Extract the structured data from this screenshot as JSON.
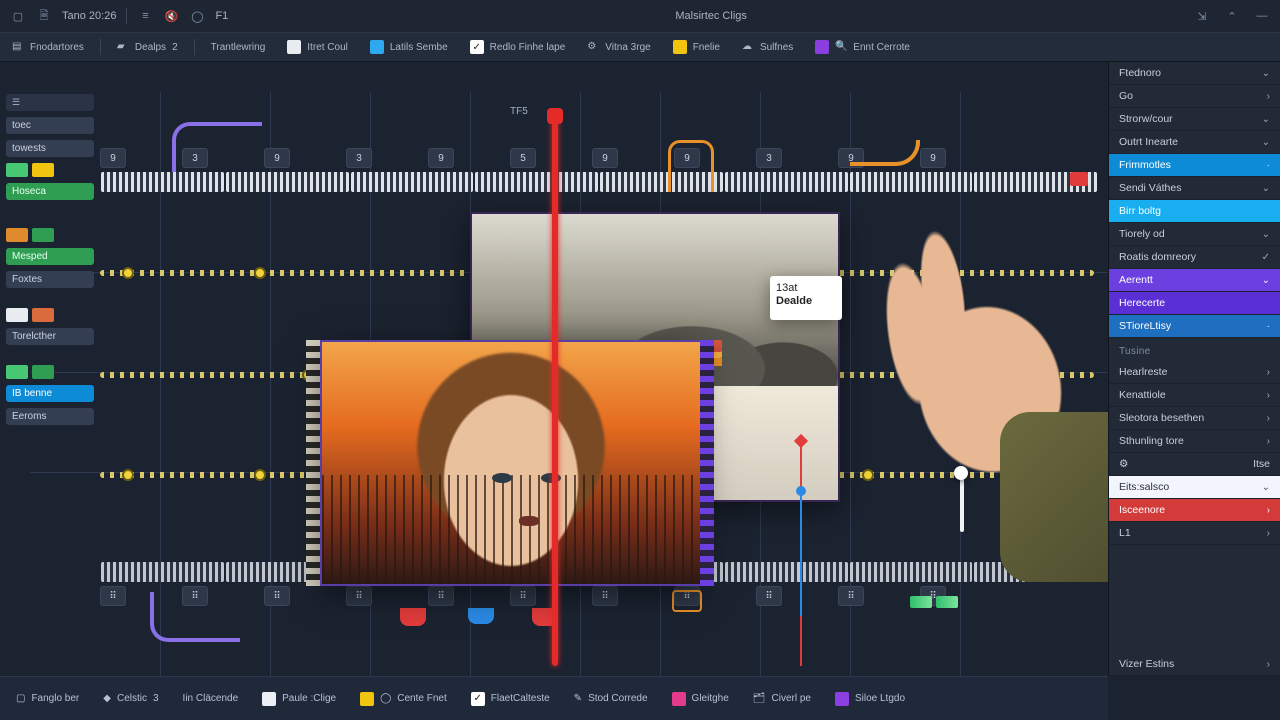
{
  "titlebar": {
    "time": "Tano 20:26",
    "center_title": "Malsirtec Cligs",
    "marker": "F1"
  },
  "toolbar": {
    "items": [
      {
        "label": "Fnodartores"
      },
      {
        "label": "Dealps",
        "badge": "2"
      },
      {
        "label": "Trantlewring"
      },
      {
        "label": "Itret Coul",
        "swatch": "#e9edf2"
      },
      {
        "label": "Latils Sembe",
        "swatch": "#2fa8ef"
      },
      {
        "label": "Redlo Finhe lape",
        "check": true
      },
      {
        "label": "Vitna 3rge"
      },
      {
        "label": "Fnelie",
        "swatch": "#f1c40f"
      },
      {
        "label": "Sulfnes"
      },
      {
        "label": "Ennt Cerrote",
        "swatch": "#8b3fe0",
        "search": true
      }
    ]
  },
  "canvas": {
    "ts_label": "TF5",
    "track_chips": {
      "toec": "toec",
      "towests": "towests",
      "poxtes": "Foxtes",
      "toeither": "Torelcther",
      "ib_benne": "IB benne",
      "eeroms": "Eeroms",
      "hoseca": "Hoseca",
      "mesped": "Mesped"
    },
    "tag_card": {
      "line1": "13at",
      "line2": "Dealde"
    }
  },
  "footer": {
    "items": [
      {
        "label": "Fanglo ber"
      },
      {
        "label": "Celstic",
        "badge": "3"
      },
      {
        "label": "Iin Cläcende"
      },
      {
        "label": "Paule :Clige",
        "swatch": "#eceff5"
      },
      {
        "label": "Cente Fnet",
        "swatch": "#f1c40f"
      },
      {
        "label": "FlaetCalteste",
        "check": true
      },
      {
        "label": "Stod Correde"
      },
      {
        "label": "Gleitghe",
        "swatch": "#e23b8b"
      },
      {
        "label": "Civerl pe"
      },
      {
        "label": "Siloe Ltgdo",
        "swatch": "#8b3fe0"
      }
    ]
  },
  "sidebar": {
    "header": "Ftednoro",
    "sec1": [
      {
        "label": "Go",
        "chev": "›"
      },
      {
        "label": "Strorw/cour",
        "chev": "⌄"
      },
      {
        "label": "Outrt Inearte",
        "chev": "⌄"
      },
      {
        "label": "Frimmotles",
        "chev": "·",
        "style": "hl-blue"
      },
      {
        "label": "Sendi Váthes",
        "chev": "⌄"
      },
      {
        "label": "Birr boltg",
        "chev": "",
        "style": "hl-cyan"
      },
      {
        "label": "Tiorely od",
        "chev": "⌄"
      },
      {
        "label": "Roatis domreory",
        "chev": "✓"
      },
      {
        "label": "Aerentt",
        "chev": "⌄",
        "style": "hl-purple"
      },
      {
        "label": "Herecerte",
        "chev": "",
        "style": "hl-purple2"
      },
      {
        "label": "STioreLtisy",
        "chev": "·",
        "style": "hl-blue3"
      }
    ],
    "group2_label": "Tusine",
    "sec2": [
      {
        "label": "Hearlreste",
        "chev": "›"
      },
      {
        "label": "Kenattiole",
        "chev": "›"
      },
      {
        "label": "Sleotora besethen",
        "chev": "›"
      },
      {
        "label": "Sthunling tore",
        "chev": "›"
      },
      {
        "label": "Itse",
        "chev": ""
      }
    ],
    "dropdown": {
      "label": "Eits:salsco",
      "value": "Eits:salsco"
    },
    "danger": "Isceenore",
    "small": "L1",
    "footer": "Vizer Estins"
  }
}
